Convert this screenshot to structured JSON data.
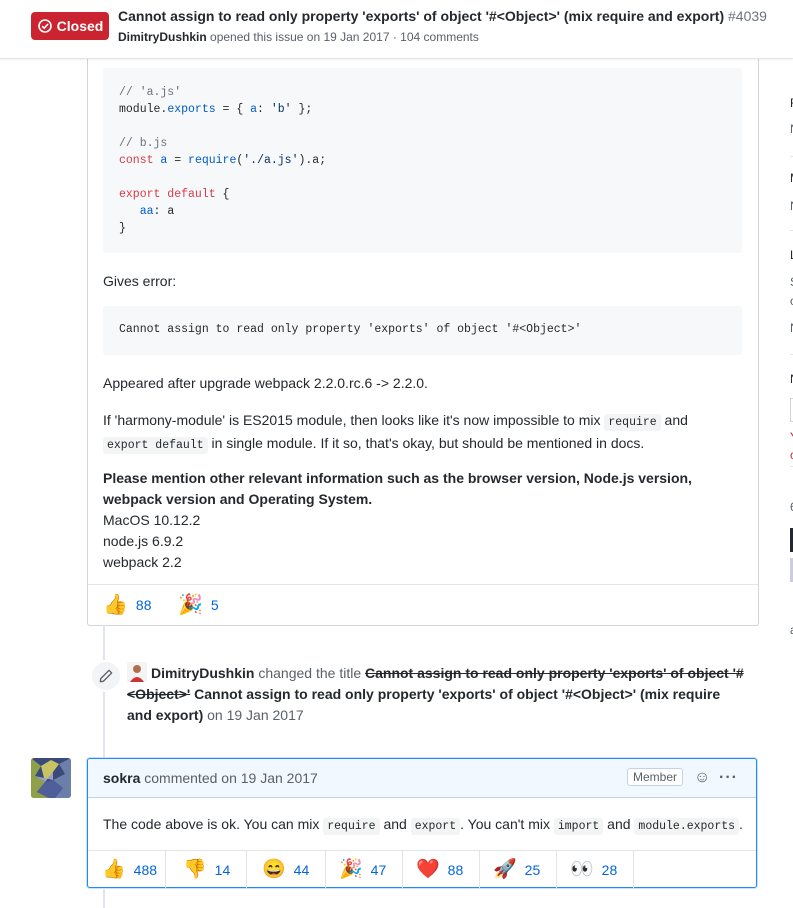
{
  "header": {
    "state_label": "Closed",
    "title": "Cannot assign to read only property 'exports' of object '#<Object>' (mix require and export)",
    "number": "#4039",
    "author": "DimitryDushkin",
    "meta_rest": "opened this issue on 19 Jan 2017 · 104 comments"
  },
  "comment1": {
    "code1_lines": [
      "// 'a.js'",
      "module.exports = { a: 'b' };",
      "",
      "// b.js",
      "const a = require('./a.js').a;",
      "",
      "export default {",
      "   aa: a",
      "}"
    ],
    "gives_error": "Gives error:",
    "error_code": "Cannot assign to read only property 'exports' of object '#<Object>'",
    "appeared": "Appeared after upgrade webpack 2.2.0.rc.6 -> 2.2.0.",
    "harmony": {
      "part1": "If 'harmony-module' is ES2015 module, then looks like it's now impossible to mix ",
      "code1": "require",
      "part2": " and ",
      "code2": "export default",
      "part3": " in single module. If it so, that's okay, but should be mentioned in docs."
    },
    "please": "Please mention other relevant information such as the browser version, Node.js version, webpack version and Operating System.",
    "env": [
      "MacOS 10.12.2",
      "node.js 6.9.2",
      "webpack 2.2"
    ],
    "reactions": [
      {
        "emoji": "👍",
        "count": "88"
      },
      {
        "emoji": "🎉",
        "count": "5"
      }
    ]
  },
  "event": {
    "actor": "DimitryDushkin",
    "action": "changed the title",
    "old_title": "Cannot assign to read only property 'exports' of object '#<Object>'",
    "new_title": "Cannot assign to read only property 'exports' of object '#<Object>' (mix require and export)",
    "date": "on 19 Jan 2017"
  },
  "comment2": {
    "author": "sokra",
    "meta": "commented on 19 Jan 2017",
    "badge": "Member",
    "body": {
      "t1": "The code above is ok. You can mix ",
      "c1": "require",
      "t2": " and ",
      "c2": "export",
      "t3": ". You can't mix ",
      "c3": "import",
      "t4": " and ",
      "c4": "module.exports",
      "t5": "."
    },
    "reactions": [
      {
        "emoji": "👍",
        "count": "488"
      },
      {
        "emoji": "👎",
        "count": "14"
      },
      {
        "emoji": "😄",
        "count": "44"
      },
      {
        "emoji": "🎉",
        "count": "47"
      },
      {
        "emoji": "❤️",
        "count": "88"
      },
      {
        "emoji": "🚀",
        "count": "25"
      },
      {
        "emoji": "👀",
        "count": "28"
      }
    ]
  },
  "colors": {
    "closed_red": "#cb2431",
    "link_blue": "#0366d6",
    "focus_blue": "#2188ff"
  }
}
